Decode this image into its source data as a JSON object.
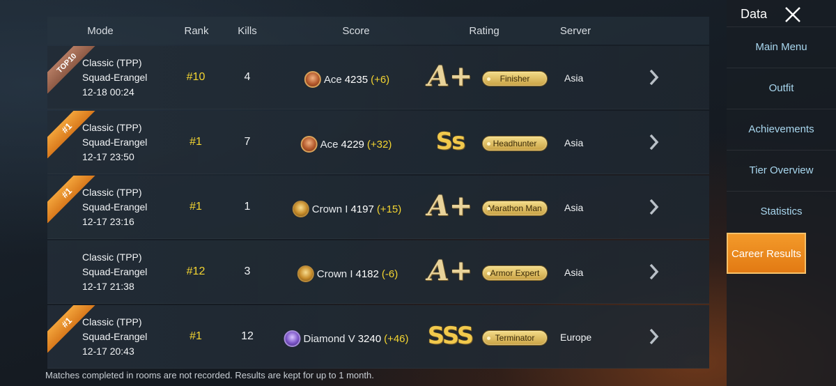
{
  "table": {
    "headers": {
      "mode": "Mode",
      "rank": "Rank",
      "kills": "Kills",
      "score": "Score",
      "rating": "Rating",
      "server": "Server"
    },
    "rows": [
      {
        "ribbon": "TOP10",
        "ribbon_style": "top",
        "mode_line1": "Classic (TPP)",
        "mode_line2": "Squad-Erangel",
        "date": "12-18 00:24",
        "rank": "#10",
        "kills": "4",
        "tier_icon": "ace-tier-icon",
        "tier": "Ace",
        "score": "4235",
        "delta": "(+6)",
        "grade": "A+",
        "badge": "Finisher",
        "server": "Asia"
      },
      {
        "ribbon": "#1",
        "ribbon_style": "gold",
        "mode_line1": "Classic (TPP)",
        "mode_line2": "Squad-Erangel",
        "date": "12-17 23:50",
        "rank": "#1",
        "kills": "7",
        "tier_icon": "ace-tier-icon",
        "tier": "Ace",
        "score": "4229",
        "delta": "(+32)",
        "grade": "Ss",
        "badge": "Headhunter",
        "server": "Asia"
      },
      {
        "ribbon": "#1",
        "ribbon_style": "gold",
        "mode_line1": "Classic (TPP)",
        "mode_line2": "Squad-Erangel",
        "date": "12-17 23:16",
        "rank": "#1",
        "kills": "1",
        "tier_icon": "crown-tier-icon",
        "tier": "Crown I",
        "score": "4197",
        "delta": "(+15)",
        "grade": "A+",
        "badge": "Marathon Man",
        "server": "Asia"
      },
      {
        "ribbon": "",
        "ribbon_style": "none",
        "mode_line1": "Classic (TPP)",
        "mode_line2": "Squad-Erangel",
        "date": "12-17 21:38",
        "rank": "#12",
        "kills": "3",
        "tier_icon": "crown-tier-icon",
        "tier": "Crown I",
        "score": "4182",
        "delta": "(-6)",
        "grade": "A+",
        "badge": "Armor Expert",
        "server": "Asia"
      },
      {
        "ribbon": "#1",
        "ribbon_style": "gold",
        "mode_line1": "Classic (TPP)",
        "mode_line2": "Squad-Erangel",
        "date": "12-17 20:43",
        "rank": "#1",
        "kills": "12",
        "tier_icon": "diamond-tier-icon",
        "tier": "Diamond V",
        "score": "3240",
        "delta": "(+46)",
        "grade": "SSS",
        "badge": "Terminator",
        "server": "Europe"
      }
    ]
  },
  "footnote": "Matches completed in rooms are not recorded. Results are kept for up to 1 month.",
  "side": {
    "title": "Data",
    "close_icon": "close-icon",
    "items": [
      {
        "label": "Main Menu"
      },
      {
        "label": "Outfit"
      },
      {
        "label": "Achievements"
      },
      {
        "label": "Tier Overview"
      },
      {
        "label": "Statistics"
      },
      {
        "label": "Career Results"
      }
    ],
    "active_index": 5,
    "accent": "#f39a2a"
  },
  "colors": {
    "rank": "#f4d531",
    "delta": "#f4d531",
    "badge": "#e6c468",
    "nav_text": "#a9d7ef"
  }
}
